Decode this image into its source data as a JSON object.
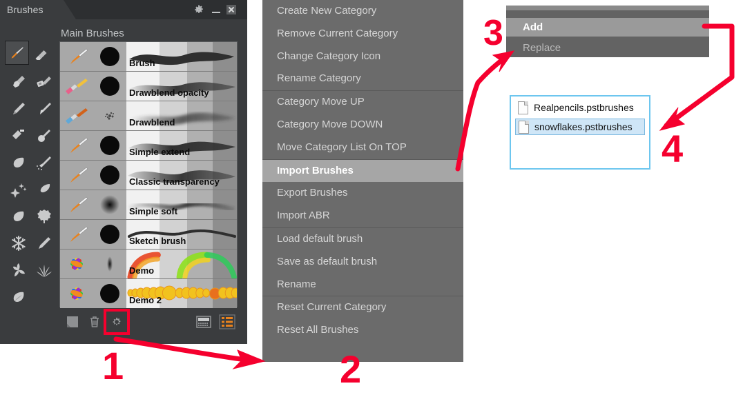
{
  "panel": {
    "tab_label": "Brushes",
    "section_label": "Main Brushes",
    "titlebar_icons": [
      "gear-icon",
      "minimize-icon",
      "close-icon"
    ],
    "tool_icons": [
      "paintbrush-icon",
      "eraser-icon",
      "fan-brush-icon",
      "flat-brush-icon",
      "pencil-icon",
      "pen-nib-icon",
      "paint-roller-icon",
      "round-dab-icon",
      "leaf-icon",
      "spray-can-icon",
      "stars-icon",
      "feather-brush-icon",
      "leaf-2-icon",
      "tree-icon",
      "snowflake-icon",
      "pencil-2-icon",
      "trefoil-leaf-icon",
      "grass-icon",
      "leaf-3-icon"
    ],
    "selected_tool": "paintbrush-icon",
    "brushes": [
      {
        "name": "Brush",
        "icon": "paintbrush-icon",
        "tip": "hard-round-tip",
        "stroke": "solid-wave"
      },
      {
        "name": "Drawblend opacity",
        "icon": "flat-brush-icon",
        "tip": "hard-round-tip",
        "stroke": "soft-wave"
      },
      {
        "name": "Drawblend",
        "icon": "flat-brush-2-icon",
        "tip": "scatter-tip",
        "stroke": "blur-wave"
      },
      {
        "name": "Simple extend",
        "icon": "paintbrush-icon",
        "tip": "hard-round-tip",
        "stroke": "taper-wave"
      },
      {
        "name": "Classic transparency",
        "icon": "paintbrush-icon",
        "tip": "hard-round-tip",
        "stroke": "opacity-wave"
      },
      {
        "name": "Simple soft",
        "icon": "paintbrush-icon",
        "tip": "soft-round-tip",
        "stroke": "soft-thin-wave"
      },
      {
        "name": "Sketch brush",
        "icon": "paintbrush-icon",
        "tip": "hard-round-tip",
        "stroke": "thin-wave"
      },
      {
        "name": "Demo",
        "icon": "color-star-icon",
        "tip": "small-soft-tip",
        "stroke": "rainbow-arc"
      },
      {
        "name": "Demo 2",
        "icon": "color-star-icon",
        "tip": "hard-round-tip",
        "stroke": "yellow-dots"
      }
    ],
    "bottom_icons": [
      "duplicate-icon",
      "trash-icon",
      "gear-icon",
      "grid-view-icon",
      "list-view-icon"
    ]
  },
  "context_menu": {
    "groups": [
      {
        "items": [
          {
            "label": "Create New Category",
            "highlighted": false
          },
          {
            "label": "Remove Current Category",
            "highlighted": false
          },
          {
            "label": "Change Category Icon",
            "highlighted": false
          },
          {
            "label": "Rename Category",
            "highlighted": false
          }
        ]
      },
      {
        "items": [
          {
            "label": "Category Move UP",
            "highlighted": false
          },
          {
            "label": "Category Move DOWN",
            "highlighted": false
          },
          {
            "label": "Move Category List On TOP",
            "highlighted": false
          }
        ]
      },
      {
        "items": [
          {
            "label": "Import Brushes",
            "highlighted": true
          },
          {
            "label": "Export Brushes",
            "highlighted": false
          },
          {
            "label": "Import ABR",
            "highlighted": false
          }
        ]
      },
      {
        "items": [
          {
            "label": "Load default brush",
            "highlighted": false
          },
          {
            "label": "Save as default brush",
            "highlighted": false
          },
          {
            "label": "Rename",
            "highlighted": false
          }
        ]
      },
      {
        "items": [
          {
            "label": "Reset Current Category",
            "highlighted": false
          },
          {
            "label": "Reset All Brushes",
            "highlighted": false
          }
        ]
      }
    ]
  },
  "submenu": {
    "items": [
      {
        "label": "Add",
        "highlighted": true
      },
      {
        "label": "Replace",
        "highlighted": false
      }
    ]
  },
  "file_dialog": {
    "files": [
      {
        "name": "Realpencils.pstbrushes",
        "selected": false
      },
      {
        "name": "snowflakes.pstbrushes",
        "selected": true
      }
    ]
  },
  "annotations": {
    "accent_color": "#f5002e",
    "steps": [
      {
        "number": "1",
        "points_to": "panel-gear-button"
      },
      {
        "number": "2",
        "points_to": "context-menu"
      },
      {
        "number": "3",
        "points_to": "add-replace-submenu"
      },
      {
        "number": "4",
        "points_to": "file-dialog"
      }
    ]
  }
}
